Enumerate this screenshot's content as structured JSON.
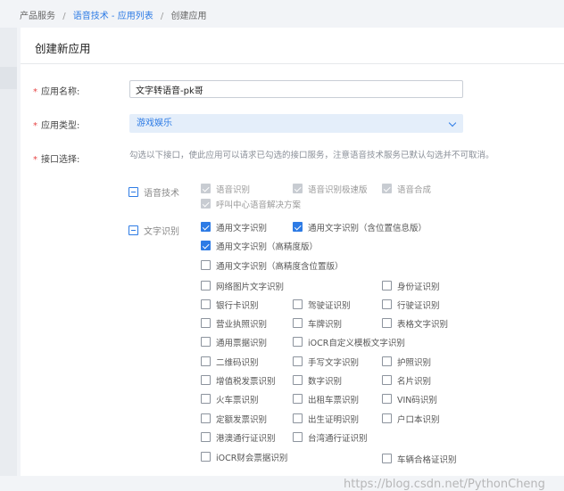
{
  "breadcrumb": {
    "item1": "产品服务",
    "item2": "语音技术 - 应用列表",
    "item3": "创建应用",
    "separator": "/"
  },
  "panel": {
    "title": "创建新应用"
  },
  "form": {
    "app_name": {
      "label": "应用名称:",
      "value": "文字转语音-pk哥"
    },
    "app_type": {
      "label": "应用类型:",
      "selected": "游戏娱乐"
    },
    "interfaces": {
      "label": "接口选择:",
      "hint": "勾选以下接口，使此应用可以请求已勾选的接口服务，注意语音技术服务已默认勾选并不可取消。"
    },
    "required_mark": "*"
  },
  "groups": {
    "speech": {
      "label": "语音技术",
      "options": [
        {
          "label": "语音识别",
          "checked": true,
          "disabled": true
        },
        {
          "label": "语音识别极速版",
          "checked": true,
          "disabled": true
        },
        {
          "label": "语音合成",
          "checked": true,
          "disabled": true
        },
        {
          "label": "呼叫中心语音解决方案",
          "checked": true,
          "disabled": true
        }
      ]
    },
    "ocr": {
      "label": "文字识别",
      "options": [
        {
          "label": "通用文字识别",
          "checked": true
        },
        {
          "label": "通用文字识别（含位置信息版）",
          "checked": true
        },
        {
          "label": "通用文字识别（高精度版）",
          "checked": true
        },
        {
          "label": "通用文字识别（高精度含位置版）",
          "checked": false
        },
        {
          "label": "网络图片文字识别",
          "checked": false
        },
        {
          "label": "身份证识别",
          "checked": false
        },
        {
          "label": "银行卡识别",
          "checked": false
        },
        {
          "label": "驾驶证识别",
          "checked": false
        },
        {
          "label": "行驶证识别",
          "checked": false
        },
        {
          "label": "营业执照识别",
          "checked": false
        },
        {
          "label": "车牌识别",
          "checked": false
        },
        {
          "label": "表格文字识别",
          "checked": false
        },
        {
          "label": "通用票据识别",
          "checked": false
        },
        {
          "label": "iOCR自定义模板文字识别",
          "checked": false
        },
        {
          "label": "二维码识别",
          "checked": false
        },
        {
          "label": "手写文字识别",
          "checked": false
        },
        {
          "label": "护照识别",
          "checked": false
        },
        {
          "label": "增值税发票识别",
          "checked": false
        },
        {
          "label": "数字识别",
          "checked": false
        },
        {
          "label": "名片识别",
          "checked": false
        },
        {
          "label": "火车票识别",
          "checked": false
        },
        {
          "label": "出租车票识别",
          "checked": false
        },
        {
          "label": "VIN码识别",
          "checked": false
        },
        {
          "label": "定额发票识别",
          "checked": false
        },
        {
          "label": "出生证明识别",
          "checked": false
        },
        {
          "label": "户口本识别",
          "checked": false
        },
        {
          "label": "港澳通行证识别",
          "checked": false
        },
        {
          "label": "台湾通行证识别",
          "checked": false
        },
        {
          "label": "iOCR财会票据识别",
          "checked": false
        },
        {
          "label": "车辆合格证识别",
          "checked": false
        }
      ]
    }
  },
  "watermark": "https://blog.csdn.net/PythonCheng",
  "colors": {
    "accent": "#2d7be5",
    "required": "#e64545"
  }
}
